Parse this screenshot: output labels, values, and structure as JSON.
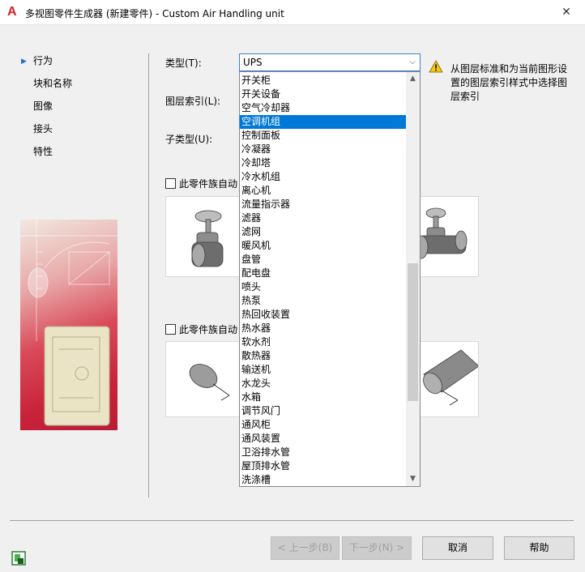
{
  "window": {
    "title": "多视图零件生成器 (新建零件) - Custom Air Handling unit",
    "app_icon": "autocad-a-icon",
    "close_glyph": "✕"
  },
  "nav": {
    "items": [
      {
        "label": "行为",
        "active": true
      },
      {
        "label": "块和名称"
      },
      {
        "label": "图像"
      },
      {
        "label": "接头"
      },
      {
        "label": "特性"
      }
    ]
  },
  "form": {
    "type_label": "类型(T):",
    "type_value": "UPS",
    "layer_index_label": "图层索引(L):",
    "subtype_label": "子类型(U):",
    "checkbox1_label": "此零件族自动",
    "checkbox2_label": "此零件族自动"
  },
  "warning": {
    "text": "从图层标准和为当前图形设置的图层索引样式中选择图层索引"
  },
  "dropdown": {
    "items": [
      "开关柜",
      "开关设备",
      "空气冷却器",
      "空调机组",
      "控制面板",
      "冷凝器",
      "冷却塔",
      "冷水机组",
      "离心机",
      "流量指示器",
      "滤器",
      "滤网",
      "暖风机",
      "盘管",
      "配电盘",
      "喷头",
      "热泵",
      "热回收装置",
      "热水器",
      "软水剂",
      "散热器",
      "输送机",
      "水龙头",
      "水箱",
      "调节风门",
      "通风柜",
      "通风装置",
      "卫浴排水管",
      "屋顶排水管",
      "洗涤槽"
    ],
    "selected_index": 3
  },
  "buttons": {
    "back": "< 上一步(B)",
    "next": "下一步(N) >",
    "cancel": "取消",
    "help": "帮助"
  },
  "colors": {
    "accent": "#0078d7",
    "selection": "#0078d7",
    "warning": "#f2c811",
    "logo": "#d6202b"
  }
}
